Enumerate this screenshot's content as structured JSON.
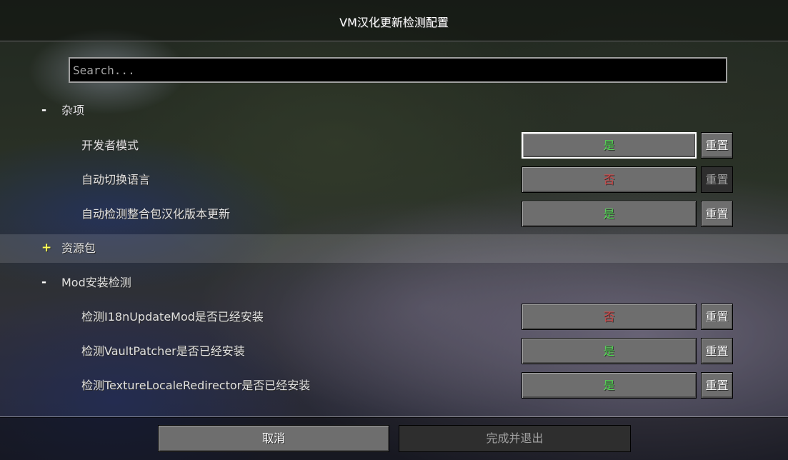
{
  "window": {
    "title": "VM汉化更新检测配置"
  },
  "search": {
    "placeholder": "Search...",
    "value": ""
  },
  "categories": [
    {
      "symbol": "-",
      "symbol_color": "#ffffff",
      "label": "杂项",
      "items": [
        {
          "label": "开发者模式",
          "value": "是",
          "value_color": "#55dd55",
          "reset_label": "重置",
          "reset_enabled": true
        },
        {
          "label": "自动切换语言",
          "value": "否",
          "value_color": "#d84848",
          "reset_label": "重置",
          "reset_enabled": false
        },
        {
          "label": "自动检测整合包汉化版本更新",
          "value": "是",
          "value_color": "#55dd55",
          "reset_label": "重置",
          "reset_enabled": true
        }
      ]
    },
    {
      "symbol": "+",
      "symbol_color": "#ffff55",
      "label": "资源包",
      "items": []
    },
    {
      "symbol": "-",
      "symbol_color": "#ffffff",
      "label": "Mod安装检测",
      "items": [
        {
          "label": "检测I18nUpdateMod是否已经安装",
          "value": "否",
          "value_color": "#d84848",
          "reset_label": "重置",
          "reset_enabled": true
        },
        {
          "label": "检测VaultPatcher是否已经安装",
          "value": "是",
          "value_color": "#55dd55",
          "reset_label": "重置",
          "reset_enabled": true
        },
        {
          "label": "检测TextureLocaleRedirector是否已经安装",
          "value": "是",
          "value_color": "#55dd55",
          "reset_label": "重置",
          "reset_enabled": true
        }
      ]
    }
  ],
  "footer": {
    "cancel": {
      "label": "取消",
      "enabled": true
    },
    "done": {
      "label": "完成并退出",
      "enabled": false
    }
  }
}
